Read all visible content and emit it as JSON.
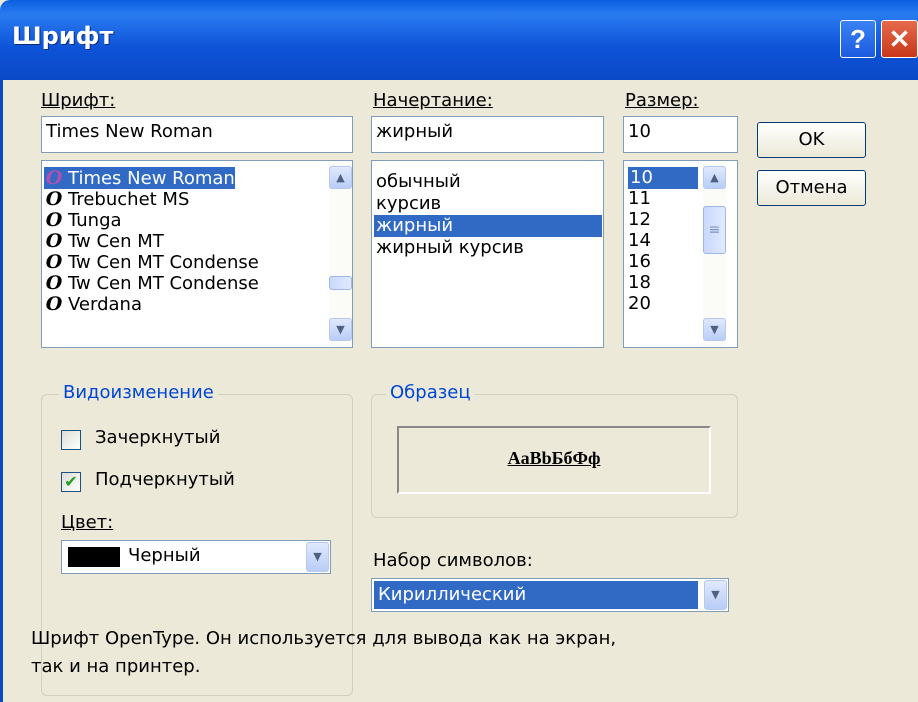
{
  "window": {
    "title": "Шрифт"
  },
  "font": {
    "label": "Шрифт:",
    "value": "Times New Roman",
    "items": [
      "Times New Roman",
      "Trebuchet MS",
      "Tunga",
      "Tw Cen MT",
      "Tw Cen MT Condense",
      "Tw Cen MT Condense",
      "Verdana"
    ],
    "selected": "Times New Roman"
  },
  "style": {
    "label": "Начертание:",
    "value": "жирный",
    "items": [
      "обычный",
      "курсив",
      "жирный",
      "жирный курсив"
    ],
    "selected": "жирный"
  },
  "size": {
    "label": "Размер:",
    "value": "10",
    "items": [
      "10",
      "11",
      "12",
      "14",
      "16",
      "18",
      "20"
    ],
    "selected": "10"
  },
  "buttons": {
    "ok": "OK",
    "cancel": "Отмена"
  },
  "effects": {
    "title": "Видоизменение",
    "strikeout": "Зачеркнутый",
    "strikeout_checked": false,
    "underline": "Подчеркнутый",
    "underline_checked": true,
    "color_label": "Цвет:",
    "color_value": "Черный",
    "color_swatch": "#000000"
  },
  "sample": {
    "title": "Образец",
    "text": "AaBbБбФф"
  },
  "charset": {
    "label": "Набор символов:",
    "value": "Кириллический"
  },
  "description": {
    "line1": "Шрифт OpenType. Он используется для вывода как на экран,",
    "line2": "так и на принтер."
  },
  "colors": {
    "accent": "#316ac5",
    "titlebar": "#0a5fe0",
    "group_title": "#0046d5"
  }
}
